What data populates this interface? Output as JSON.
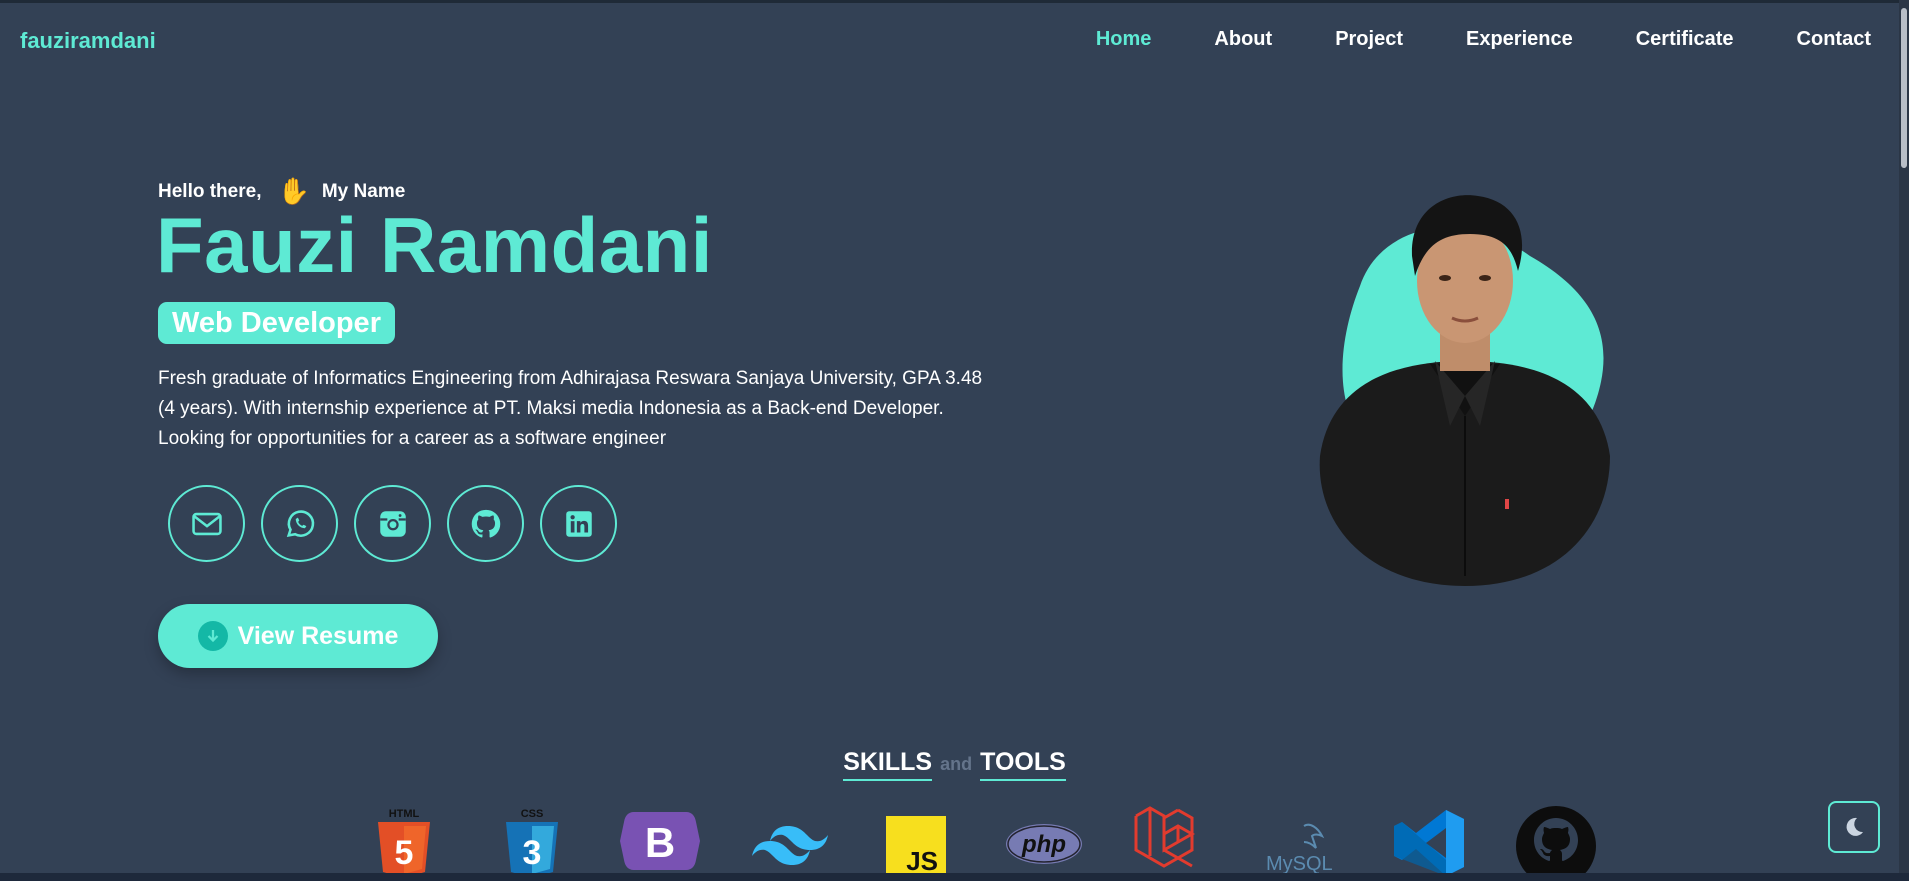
{
  "nav": {
    "logo": "fauziramdani",
    "items": [
      {
        "label": "Home",
        "active": true
      },
      {
        "label": "About",
        "active": false
      },
      {
        "label": "Project",
        "active": false
      },
      {
        "label": "Experience",
        "active": false
      },
      {
        "label": "Certificate",
        "active": false
      },
      {
        "label": "Contact",
        "active": false
      }
    ]
  },
  "hero": {
    "greeting": "Hello there,",
    "greeting_icon": "waving-hand-icon",
    "greeting_suffix": "My Name",
    "name": "Fauzi Ramdani",
    "role": "Web Developer",
    "description": "Fresh graduate of Informatics Engineering from Adhirajasa Reswara Sanjaya University, GPA 3.48 (4 years). With internship experience at PT. Maksi media Indonesia as a Back-end Developer. Looking for opportunities for a career as a software engineer",
    "socials": [
      "mail-icon",
      "whatsapp-icon",
      "instagram-icon",
      "github-icon",
      "linkedin-icon"
    ],
    "resume_label": "View Resume",
    "resume_icon": "download-arrow-icon"
  },
  "skills": {
    "title_left": "SKILLS",
    "title_and": "and",
    "title_right": "TOOLS",
    "tools": [
      "html5-logo",
      "css3-logo",
      "bootstrap-logo",
      "tailwind-logo",
      "javascript-logo",
      "php-logo",
      "laravel-logo",
      "mysql-logo",
      "vscode-logo",
      "github-logo"
    ],
    "text": {
      "html": "HTML",
      "css": "CSS",
      "bootstrap": "B",
      "js": "JS",
      "php": "php",
      "mysql": "MySQL"
    }
  },
  "colors": {
    "accent": "#5eead4",
    "background": "#334155"
  }
}
